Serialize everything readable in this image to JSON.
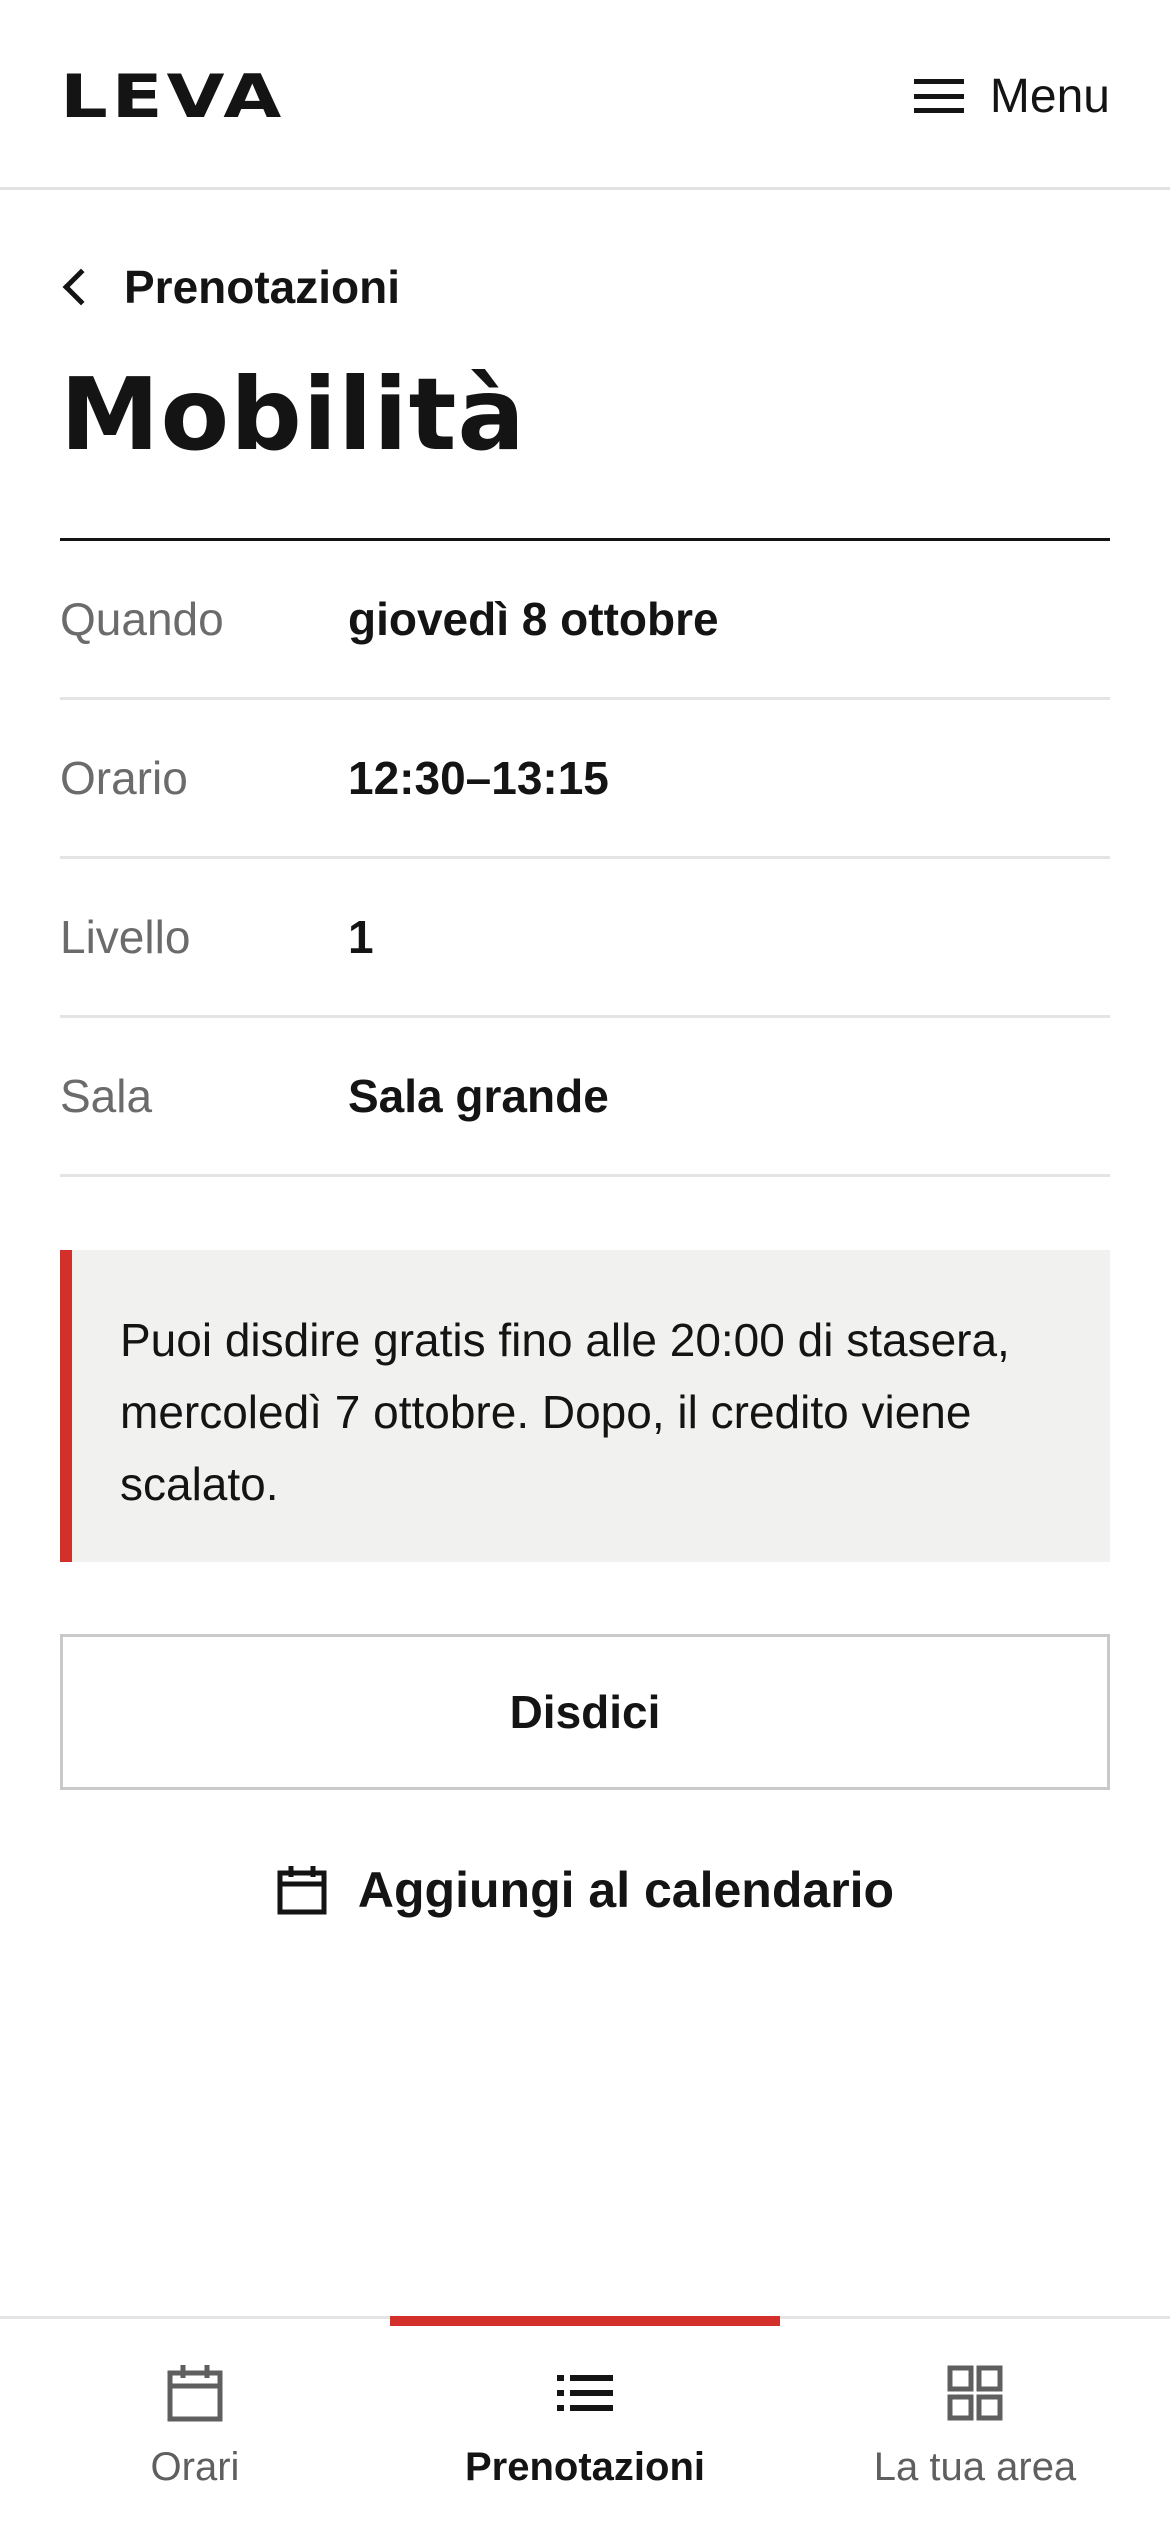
{
  "header": {
    "logo": "LEVA",
    "menu_label": "Menu"
  },
  "back": {
    "label": "Prenotazioni"
  },
  "page_title": "Mobilità",
  "details": [
    {
      "label": "Quando",
      "value": "giovedì 8 ottobre"
    },
    {
      "label": "Orario",
      "value": "12:30–13:15"
    },
    {
      "label": "Livello",
      "value": "1"
    },
    {
      "label": "Sala",
      "value": "Sala grande"
    }
  ],
  "notice": {
    "text": "Puoi disdire gratis fino alle 20:00 di stasera, mercoledì 7 ottobre. Dopo, il credito viene scalato.",
    "accent_color": "#d3302c"
  },
  "actions": {
    "cancel_label": "Disdici",
    "calendar_label": "Aggiungi al calendario",
    "calendar_icon": "calendar-icon"
  },
  "bottom_nav": {
    "active": "Prenotazioni",
    "items": [
      {
        "label": "Orari",
        "icon": "calendar-icon"
      },
      {
        "label": "Prenotazioni",
        "icon": "list-icon"
      },
      {
        "label": "La tua area",
        "icon": "grid-icon"
      }
    ]
  }
}
